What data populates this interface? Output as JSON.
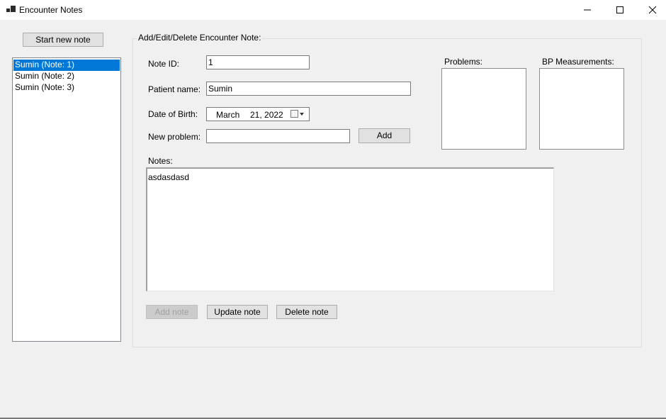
{
  "window": {
    "title": "Encounter Notes"
  },
  "left": {
    "start_new_note_label": "Start new note",
    "notes_list": [
      {
        "label": "Sumin (Note: 1)",
        "selected": true
      },
      {
        "label": "Sumin (Note: 2)",
        "selected": false
      },
      {
        "label": "Sumin (Note: 3)",
        "selected": false
      }
    ]
  },
  "form": {
    "group_title": "Add/Edit/Delete Encounter Note:",
    "note_id": {
      "label": "Note ID:",
      "value": "1"
    },
    "patient_name": {
      "label": "Patient name:",
      "value": "Sumin"
    },
    "date_of_birth": {
      "label": "Date of Birth:",
      "month": "March",
      "day_year": "21, 2022"
    },
    "new_problem": {
      "label": "New problem:",
      "value": "",
      "add_label": "Add"
    },
    "problems_label": "Problems:",
    "bp_label": "BP Measurements:",
    "notes": {
      "label": "Notes:",
      "value": "asdasdasd"
    },
    "buttons": {
      "add_note": "Add note",
      "update_note": "Update note",
      "delete_note": "Delete note"
    }
  }
}
